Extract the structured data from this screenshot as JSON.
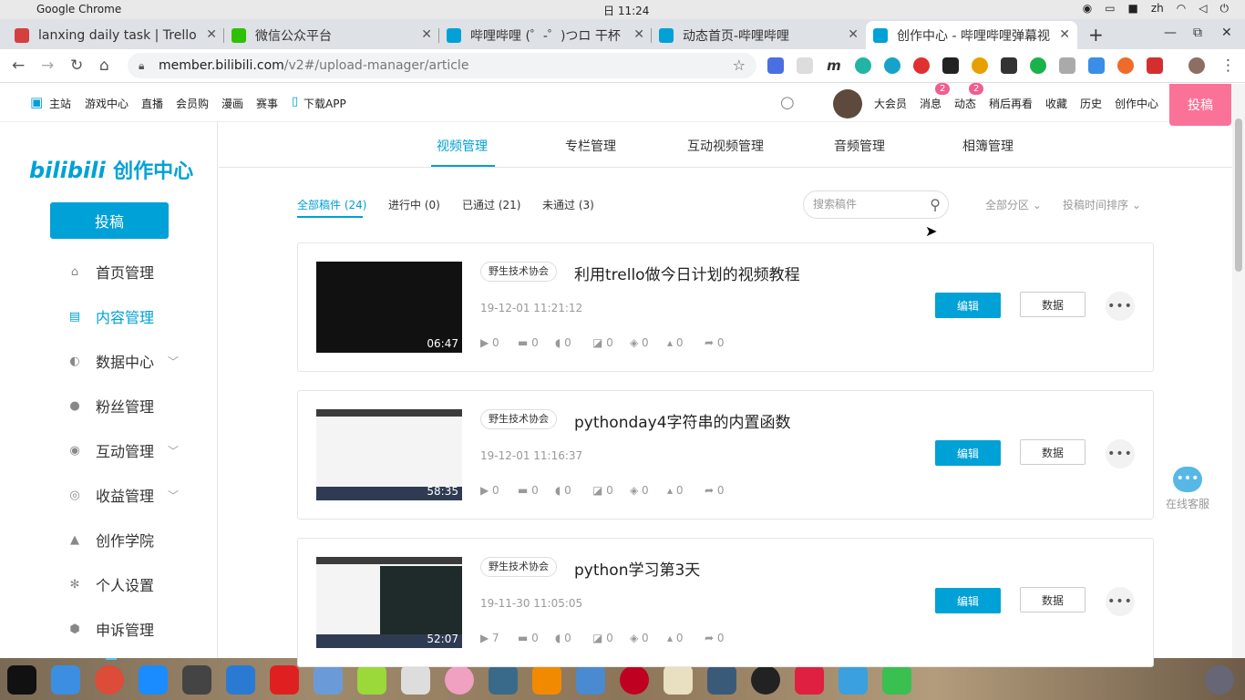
{
  "os": {
    "app_name": "Google Chrome",
    "clock": "日 11:24",
    "lang": "zh"
  },
  "tabs": [
    {
      "title": "lanxing daily task | Trello",
      "fav": "trello-icon",
      "color": "#d63f3f"
    },
    {
      "title": "微信公众平台",
      "fav": "wechat-icon",
      "color": "#2dc100"
    },
    {
      "title": "哔哩哔哩 (゜-゜)つロ 干杯",
      "fav": "bilibili-icon",
      "color": "#00a1d6"
    },
    {
      "title": "动态首页-哔哩哔哩",
      "fav": "bilibili-icon",
      "color": "#00a1d6"
    },
    {
      "title": "创作中心 - 哔哩哔哩弹幕视",
      "fav": "bilibili-icon",
      "color": "#00a1d6"
    }
  ],
  "address": {
    "host": "member.bilibili.com",
    "path": "/v2#/upload-manager/article"
  },
  "site_nav": {
    "left": [
      "主站",
      "游戏中心",
      "直播",
      "会员购",
      "漫画",
      "赛事",
      "下载APP"
    ],
    "right": [
      "大会员",
      "消息",
      "动态",
      "稍后再看",
      "收藏",
      "历史",
      "创作中心"
    ],
    "msg_badge": "2",
    "dyn_badge": "2",
    "post": "投稿"
  },
  "sidebar": {
    "logo": "bilibili",
    "logo_cn": "创作中心",
    "post": "投稿",
    "items": [
      {
        "label": "首页管理",
        "icon": "home-icon",
        "chev": false
      },
      {
        "label": "内容管理",
        "icon": "document-icon",
        "chev": false
      },
      {
        "label": "数据中心",
        "icon": "chart-icon",
        "chev": true
      },
      {
        "label": "粉丝管理",
        "icon": "user-icon",
        "chev": false
      },
      {
        "label": "互动管理",
        "icon": "chat-icon",
        "chev": true
      },
      {
        "label": "收益管理",
        "icon": "coin-icon",
        "chev": true
      },
      {
        "label": "创作学院",
        "icon": "graduation-icon",
        "chev": false
      },
      {
        "label": "个人设置",
        "icon": "gear-icon",
        "chev": false
      },
      {
        "label": "申诉管理",
        "icon": "shield-icon",
        "chev": false
      }
    ]
  },
  "main_tabs": [
    "视频管理",
    "专栏管理",
    "互动视频管理",
    "音频管理",
    "相簿管理"
  ],
  "filters": [
    "全部稿件 (24)",
    "进行中 (0)",
    "已通过 (21)",
    "未通过 (3)"
  ],
  "search_placeholder": "搜索稿件",
  "sort": {
    "zone": "全部分区",
    "time": "投稿时间排序"
  },
  "videos": [
    {
      "tag": "野生技术协会",
      "title": "利用trello做今日计划的视频教程",
      "date": "19-12-01 11:21:12",
      "duration": "06:47",
      "stats": [
        "0",
        "0",
        "0",
        "0",
        "0",
        "0",
        "0"
      ],
      "dark": true
    },
    {
      "tag": "野生技术协会",
      "title": "pythonday4字符串的内置函数",
      "date": "19-12-01 11:16:37",
      "duration": "58:35",
      "stats": [
        "0",
        "0",
        "0",
        "0",
        "0",
        "0",
        "0"
      ],
      "dark": false
    },
    {
      "tag": "野生技术协会",
      "title": "python学习第3天",
      "date": "19-11-30 11:05:05",
      "duration": "52:07",
      "stats": [
        "7",
        "0",
        "0",
        "0",
        "0",
        "0",
        "0"
      ],
      "dark": false
    }
  ],
  "buttons": {
    "edit": "编辑",
    "data": "数据",
    "more": "•••"
  },
  "service": "在线客服"
}
